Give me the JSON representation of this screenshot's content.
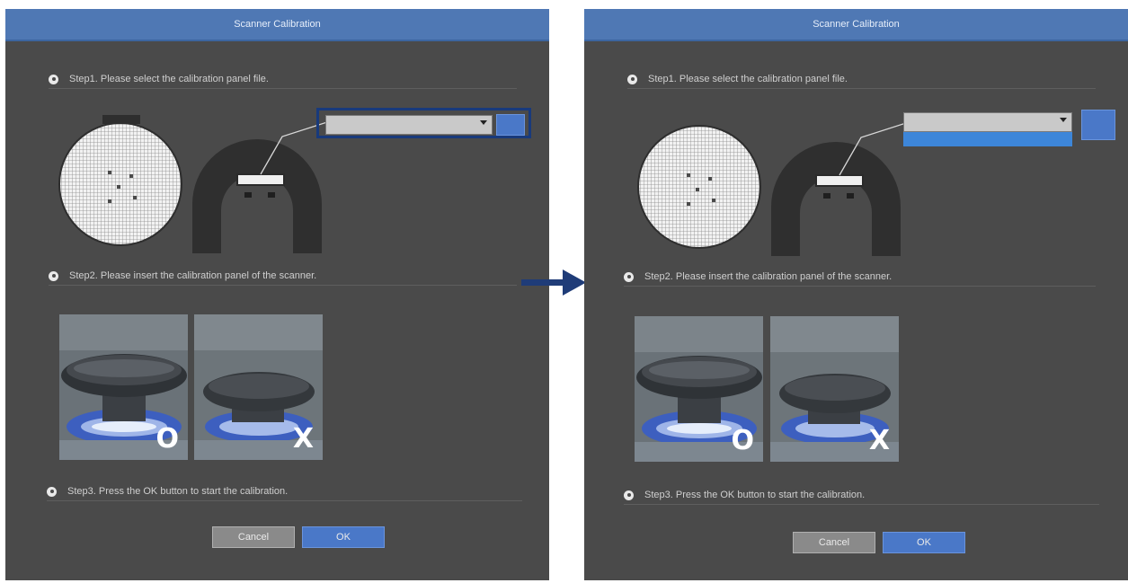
{
  "left_dialog": {
    "title": "Scanner Calibration",
    "step1": "Step1. Please select the calibration panel file.",
    "step2": "Step2. Please insert the calibration panel of the scanner.",
    "step3": "Step3. Press the OK button to start the calibration.",
    "select_value": "",
    "cancel_label": "Cancel",
    "ok_label": "OK",
    "correct_mark": "O",
    "wrong_mark": "X"
  },
  "right_dialog": {
    "title": "Scanner Calibration",
    "step1": "Step1. Please select the calibration panel file.",
    "step2": "Step2. Please insert the calibration panel of the scanner.",
    "step3": "Step3. Press the OK button to start the calibration.",
    "select_value": "",
    "dropdown_option": "",
    "cancel_label": "Cancel",
    "ok_label": "OK",
    "correct_mark": "O",
    "wrong_mark": "X"
  },
  "colors": {
    "title_bar": "#4f78b4",
    "panel_bg": "#4a4a4a",
    "accent_button": "#4a78c8",
    "highlight_frame": "#183a7c",
    "connector_arrow": "#1f3c78"
  },
  "icons": [
    "calibration-panel-icon",
    "scanner-tip-icon",
    "chevron-down-icon",
    "radio-bullet-icon",
    "right-arrow-icon"
  ]
}
